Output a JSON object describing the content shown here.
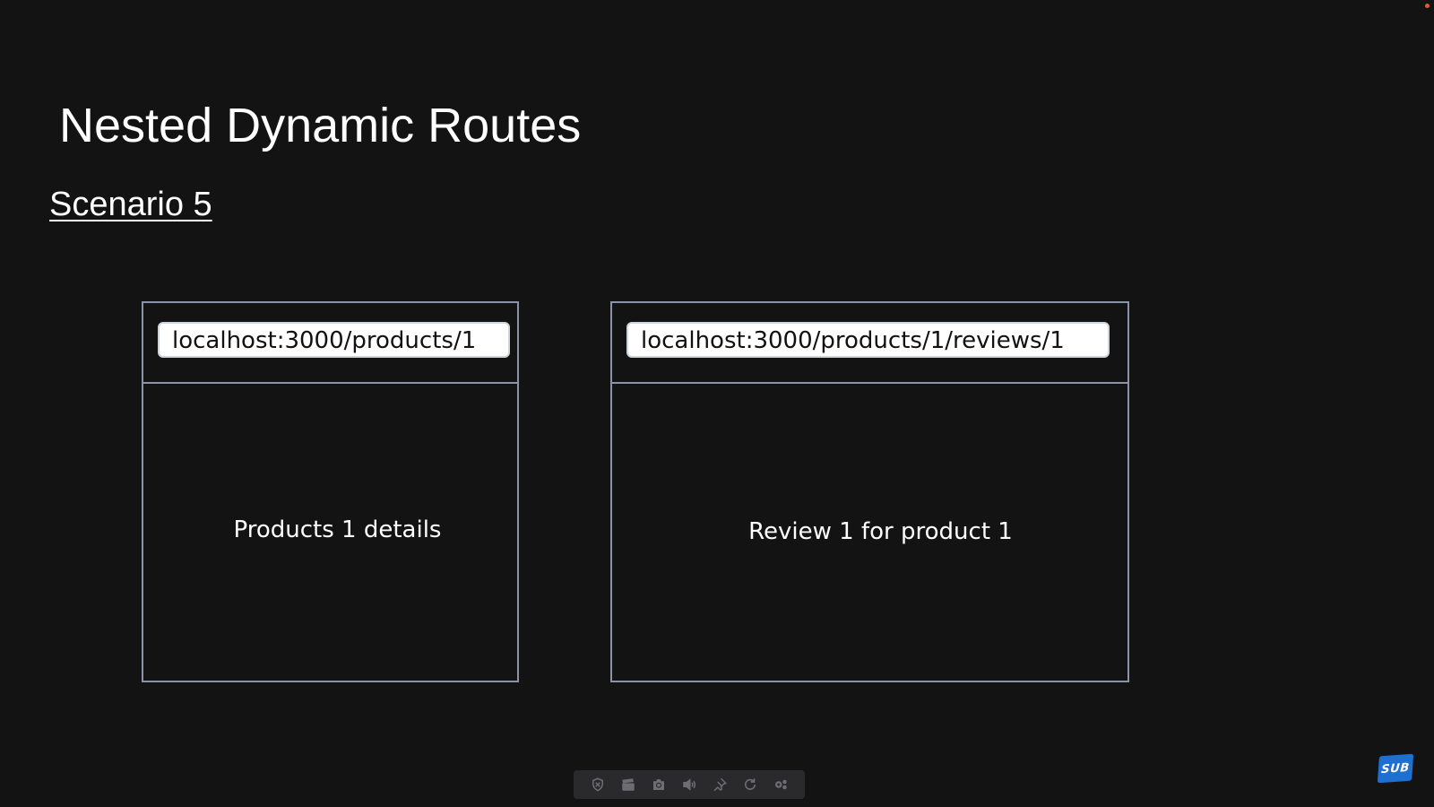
{
  "slide": {
    "title": "Nested Dynamic Routes",
    "subtitle": "Scenario 5"
  },
  "browsers": [
    {
      "url": "localhost:3000/products/1",
      "content": "Products 1 details"
    },
    {
      "url": "localhost:3000/products/1/reviews/1",
      "content": "Review 1 for product 1"
    }
  ],
  "toolbar": {
    "icons": [
      "shield-icon",
      "clapperboard-icon",
      "camera-icon",
      "speaker-icon",
      "pin-icon",
      "refresh-icon",
      "settings-icon"
    ]
  },
  "badge": {
    "label": "SUB",
    "color": "#1d6fd0"
  },
  "colors": {
    "background": "#141314",
    "frame_border": "#8a94a6",
    "text": "#ffffff"
  }
}
